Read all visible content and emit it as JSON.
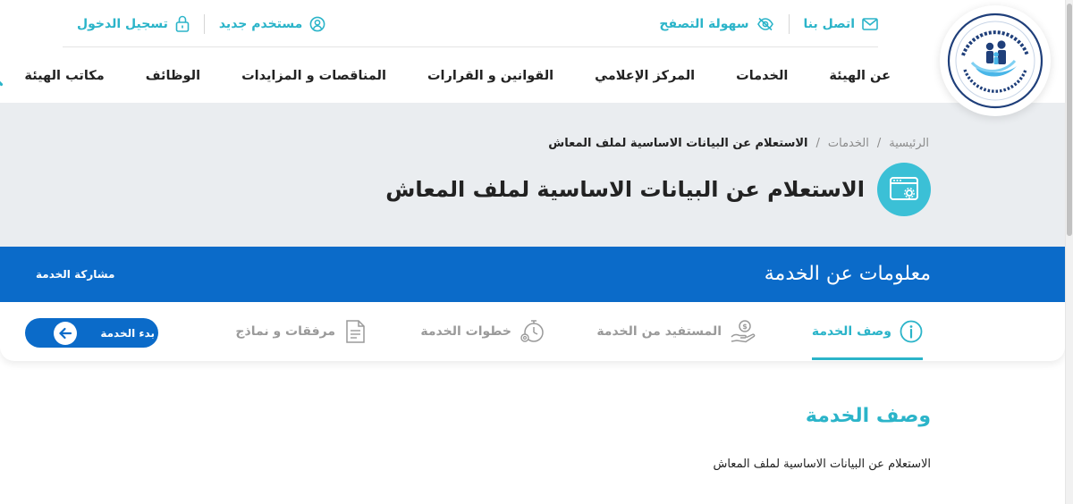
{
  "topbar": {
    "contact": "اتصل بنا",
    "accessibility": "سهولة التصفح",
    "new_user": "مستخدم جديد",
    "login": "تسجيل الدخول"
  },
  "nav": {
    "items": [
      {
        "label": "عن الهيئة"
      },
      {
        "label": "الخدمات"
      },
      {
        "label": "المركز الإعلامي"
      },
      {
        "label": "القوانين و القرارات"
      },
      {
        "label": "المناقصات و المزايدات"
      },
      {
        "label": "الوظائف"
      },
      {
        "label": "مكاتب الهيئة"
      }
    ]
  },
  "breadcrumb": {
    "home": "الرئيسية",
    "services": "الخدمات",
    "current": "الاستعلام عن البيانات الاساسية لملف المعاش"
  },
  "hero": {
    "title": "الاستعلام عن البيانات الاساسية لملف المعاش"
  },
  "band": {
    "title": "معلومات عن الخدمة",
    "share": "مشاركة الخدمة"
  },
  "tabs": {
    "items": [
      {
        "label": "وصف الخدمة",
        "active": true,
        "icon": "info-icon"
      },
      {
        "label": "المستفيد من الخدمة",
        "active": false,
        "icon": "beneficiary-icon"
      },
      {
        "label": "خطوات الخدمة",
        "active": false,
        "icon": "steps-icon"
      },
      {
        "label": "مرفقات و نماذج",
        "active": false,
        "icon": "document-icon"
      }
    ],
    "start_label": "بدء الخدمة"
  },
  "content": {
    "section_title": "وصف الخدمة",
    "section_text": "الاستعلام عن البيانات الاساسية لملف المعاش"
  },
  "colors": {
    "accent": "#2bb4c9",
    "primary_blue": "#0b6bc9",
    "hero_bg": "#eaedf0"
  }
}
